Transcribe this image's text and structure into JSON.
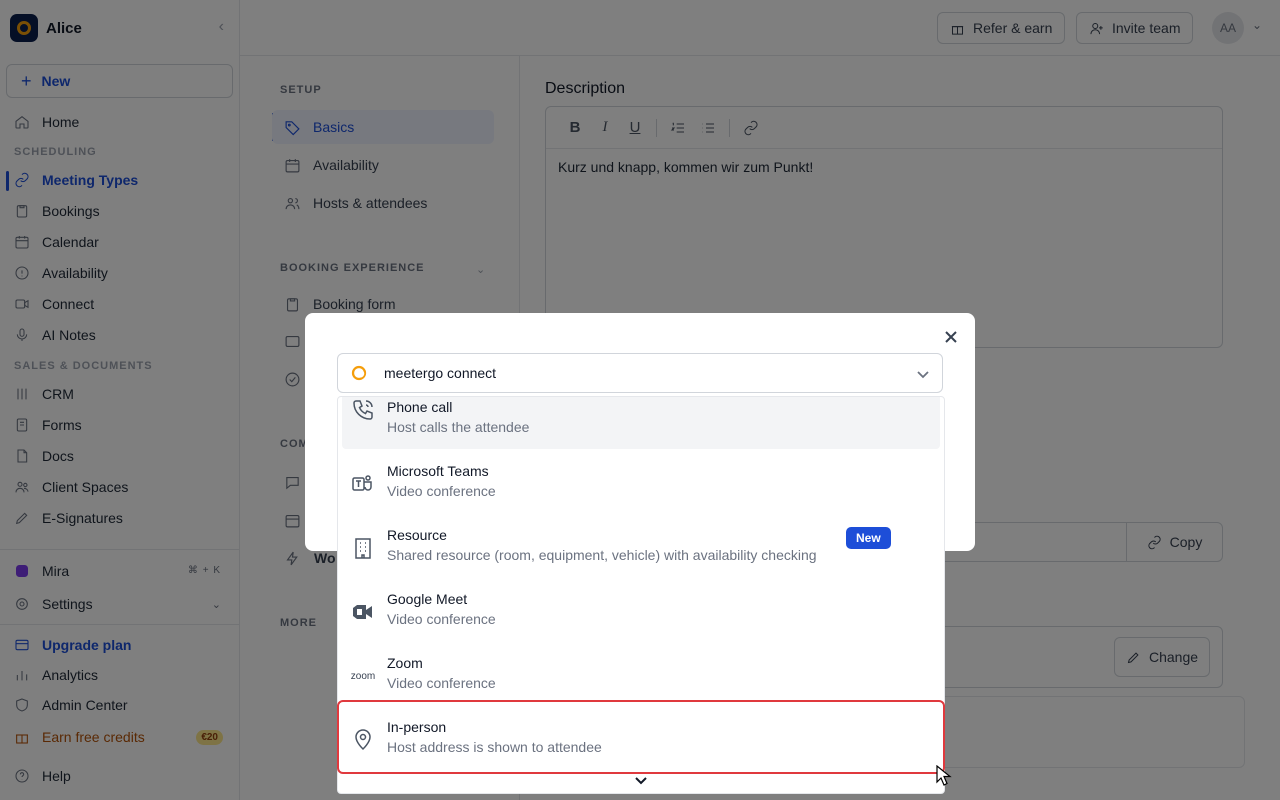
{
  "workspace": {
    "name": "Alice"
  },
  "sidebar": {
    "new_label": "New",
    "home": "Home",
    "section_scheduling": "SCHEDULING",
    "meeting_types": "Meeting Types",
    "bookings": "Bookings",
    "calendar": "Calendar",
    "availability": "Availability",
    "connect": "Connect",
    "ai_notes": "AI Notes",
    "section_sales": "SALES & DOCUMENTS",
    "crm": "CRM",
    "forms": "Forms",
    "docs": "Docs",
    "client_spaces": "Client Spaces",
    "e_signatures": "E-Signatures",
    "mira": "Mira",
    "mira_shortcut": "⌘ + K",
    "settings": "Settings",
    "upgrade": "Upgrade plan",
    "analytics": "Analytics",
    "admin_center": "Admin Center",
    "earn_credits": "Earn free credits",
    "earn_badge": "€20",
    "help": "Help"
  },
  "topbar": {
    "refer": "Refer & earn",
    "invite": "Invite team",
    "avatar_initials": "AA"
  },
  "settings_nav": {
    "setup_label": "SETUP",
    "basics": "Basics",
    "availability": "Availability",
    "hosts": "Hosts & attendees",
    "booking_experience_label": "BOOKING EXPERIENCE",
    "booking_form": "Booking form",
    "comm_trunc": "COM",
    "wo_trunc": "Wo",
    "more_label": "MORE"
  },
  "main": {
    "description_title": "Description",
    "description_text": "Kurz und knapp, kommen wir zum Punkt!",
    "copy_label": "Copy",
    "change_label": "Change"
  },
  "modal": {
    "selected_value": "meetergo connect"
  },
  "dropdown": {
    "options": [
      {
        "title": "Phone call",
        "subtitle": "Host calls the attendee",
        "icon": "phone-icon"
      },
      {
        "title": "Microsoft Teams",
        "subtitle": "Video conference",
        "icon": "teams-icon"
      },
      {
        "title": "Resource",
        "subtitle": "Shared resource (room, equipment, vehicle) with availability checking",
        "badge": "New",
        "icon": "building-icon"
      },
      {
        "title": "Google Meet",
        "subtitle": "Video conference",
        "icon": "google-meet-icon"
      },
      {
        "title": "Zoom",
        "subtitle": "Video conference",
        "icon": "zoom-icon",
        "icon_text": "zoom"
      },
      {
        "title": "In-person",
        "subtitle": "Host address is shown to attendee",
        "icon": "map-pin-icon"
      }
    ]
  },
  "colors": {
    "accent": "#1d4ed8",
    "highlight": "#e0393e",
    "badge": "#1d4ed8"
  }
}
